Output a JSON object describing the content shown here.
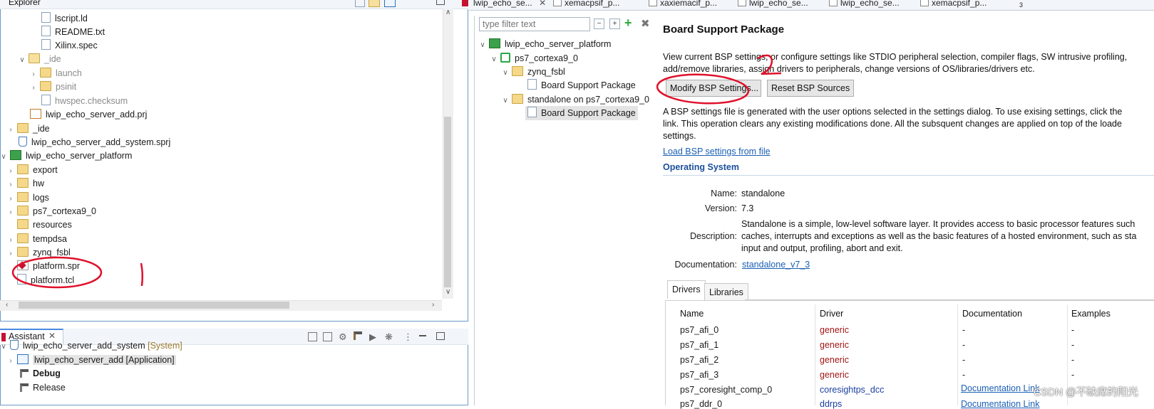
{
  "explorer": {
    "title": "Explorer",
    "items": [
      {
        "label": "lscript.ld",
        "kind": "file"
      },
      {
        "label": "README.txt",
        "kind": "file"
      },
      {
        "label": "Xilinx.spec",
        "kind": "file"
      },
      {
        "label": "_ide",
        "kind": "folder"
      },
      {
        "label": "launch",
        "kind": "folder"
      },
      {
        "label": "psinit",
        "kind": "folder"
      },
      {
        "label": "hwspec.checksum",
        "kind": "file"
      },
      {
        "label": "lwip_echo_server_add.prj",
        "kind": "file"
      },
      {
        "label": "_ide",
        "kind": "folder"
      },
      {
        "label": "lwip_echo_server_add_system.sprj",
        "kind": "file"
      },
      {
        "label": "lwip_echo_server_platform",
        "kind": "project"
      },
      {
        "label": "export",
        "kind": "folder"
      },
      {
        "label": "hw",
        "kind": "folder"
      },
      {
        "label": "logs",
        "kind": "folder"
      },
      {
        "label": "ps7_cortexa9_0",
        "kind": "folder"
      },
      {
        "label": "resources",
        "kind": "folder"
      },
      {
        "label": "tempdsa",
        "kind": "folder"
      },
      {
        "label": "zynq_fsbl",
        "kind": "folder"
      },
      {
        "label": "platform.spr",
        "kind": "file"
      },
      {
        "label": "platform.tcl",
        "kind": "file"
      }
    ]
  },
  "assistant": {
    "title": "Assistant",
    "items": [
      {
        "label": "lwip_echo_server_add_system",
        "suffix": "[System]"
      },
      {
        "label": "lwip_echo_server_add [Application]"
      },
      {
        "label": "Debug"
      },
      {
        "label": "Release"
      }
    ]
  },
  "editor_tabs": [
    {
      "label": "lwip_echo_se..."
    },
    {
      "label": "xemacpsif_p..."
    },
    {
      "label": "xaxiemacif_p..."
    },
    {
      "label": "lwip_echo_se..."
    },
    {
      "label": "lwip_echo_se..."
    },
    {
      "label": "xemacpsif_p..."
    },
    {
      "label": "3"
    }
  ],
  "bsp_tree": {
    "filter_placeholder": "type filter text",
    "items": [
      {
        "label": "lwip_echo_server_platform"
      },
      {
        "label": "ps7_cortexa9_0"
      },
      {
        "label": "zynq_fsbl"
      },
      {
        "label": "Board Support Package"
      },
      {
        "label": "standalone on ps7_cortexa9_0"
      },
      {
        "label": "Board Support Package"
      }
    ]
  },
  "bsp": {
    "title": "Board Support Package",
    "desc_line1": "View current BSP settings, or configure settings like STDIO peripheral selection, compiler flags, SW intrusive profiling,",
    "desc_line2": "add/remove libraries, assign drivers to peripherals, change versions of OS/libraries/drivers etc.",
    "modify_button": "Modify BSP Settings...",
    "reset_button": "Reset BSP Sources",
    "info_line1": "A BSP settings file is generated with the user options selected in the settings dialog. To use exising settings, click the",
    "info_line2": "link. This operation clears any existing modifications done. All the subsquent changes are applied on top of the loade",
    "info_line3": "settings.",
    "load_link": "Load BSP settings from file",
    "os_section": "Operating System",
    "name_label": "Name:",
    "name_value": "standalone",
    "version_label": "Version:",
    "version_value": "7.3",
    "description_label": "Description:",
    "description_line1": "Standalone is a simple, low-level software layer. It provides access to basic processor features such",
    "description_line2": "caches, interrupts and exceptions as well as the basic features of a hosted environment, such as sta",
    "description_line3": "input and output, profiling, abort and exit.",
    "documentation_label": "Documentation:",
    "documentation_link": "standalone_v7_3",
    "tabs": [
      "Drivers",
      "Libraries"
    ],
    "table": {
      "headers": [
        "Name",
        "Driver",
        "Documentation",
        "Examples"
      ],
      "rows": [
        [
          "ps7_afi_0",
          "generic",
          "-",
          "-"
        ],
        [
          "ps7_afi_1",
          "generic",
          "-",
          "-"
        ],
        [
          "ps7_afi_2",
          "generic",
          "-",
          "-"
        ],
        [
          "ps7_afi_3",
          "generic",
          "-",
          "-"
        ],
        [
          "ps7_coresight_comp_0",
          "coresightps_dcc",
          "Documentation Link",
          ""
        ],
        [
          "ps7_ddr_0",
          "ddrps",
          "Documentation Link",
          ""
        ]
      ]
    }
  },
  "annotations": {
    "mark_1": "1",
    "mark_2": "2"
  },
  "watermark": "CSDN @不缺席的阳光",
  "colors": {
    "accent_blue": "#1c4f9c",
    "link_blue": "#1a5fb4",
    "driver_red": "#a31515",
    "annotation_red": "#e0112b"
  }
}
